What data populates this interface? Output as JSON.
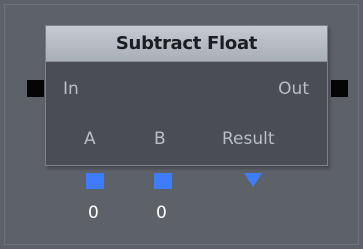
{
  "node": {
    "title": "Subtract Float",
    "inputs_exec_label": "In",
    "outputs_exec_label": "Out",
    "pins": [
      {
        "label": "A",
        "value": "0"
      },
      {
        "label": "B",
        "value": "0"
      },
      {
        "label": "Result"
      }
    ]
  },
  "colors": {
    "canvas_background": "#5d6168",
    "node_header": "#b7bcc3",
    "node_body": "#4a4e54",
    "data_pin": "#3d7dfd",
    "exec_pin": "#050505"
  },
  "icons": {
    "exec_in": "square-exec-pin-icon",
    "exec_out": "square-exec-pin-icon",
    "input_pin": "square-data-pin-icon",
    "output_pin": "triangle-down-pin-icon"
  }
}
